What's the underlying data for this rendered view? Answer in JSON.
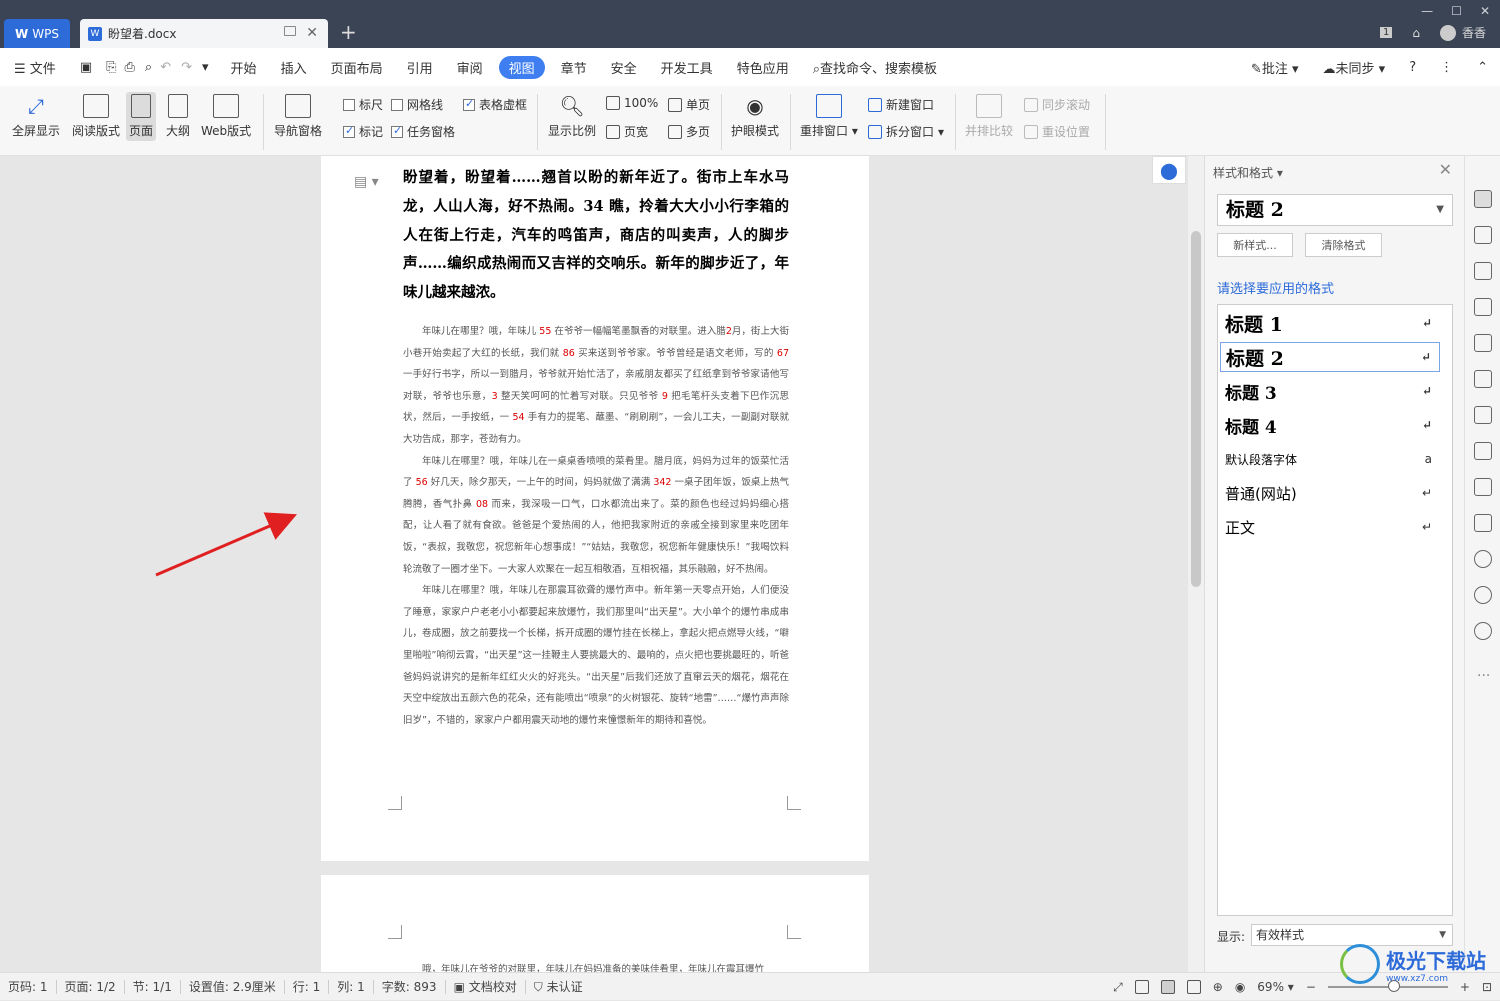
{
  "titlebar": {
    "app_tab": "WPS",
    "doc_tab": "盼望着.docx",
    "new_tab": "+",
    "account_name": "香香"
  },
  "menu": {
    "file": "文件",
    "items": [
      "开始",
      "插入",
      "页面布局",
      "引用",
      "审阅",
      "视图",
      "章节",
      "安全",
      "开发工具",
      "特色应用"
    ],
    "active": "视图",
    "search": "查找命令、搜索模板",
    "right": {
      "comment": "批注",
      "sync": "未同步"
    }
  },
  "ribbon": {
    "fullscreen": "全屏显示",
    "reading": "阅读版式",
    "page": "页面",
    "outline": "大纲",
    "web": "Web版式",
    "nav_pane": "导航窗格",
    "ruler": "标尺",
    "gridlines": "网格线",
    "table_gridlines": "表格虚框",
    "marks": "标记",
    "task_pane": "任务窗格",
    "zoom": "显示比例",
    "zoom_100": "100%",
    "single_page": "单页",
    "page_width": "页宽",
    "multi_page": "多页",
    "eye_mode": "护眼模式",
    "arrange": "重排窗口",
    "new_window": "新建窗口",
    "split_window": "拆分窗口",
    "side_by_side": "并排比较",
    "sync_scroll": "同步滚动",
    "reset_position": "重设位置"
  },
  "document": {
    "heading": "盼望着，盼望着……翘首以盼的新年近了。街市上车水马龙，人山人海，好不热闹。34 瞧，拎着大大小小行李箱的人在街上行走，汽车的鸣笛声，商店的叫卖声，人的脚步声……编织成热闹而又吉祥的交响乐。新年的脚步近了，年味儿越来越浓。",
    "p1": [
      {
        "t": "年味儿在哪里？哦，年味儿 "
      },
      {
        "t": "55",
        "red": true
      },
      {
        "t": " 在爷爷一幅幅笔墨飘香的对联里。进入腊"
      },
      {
        "t": "2",
        "red": true
      },
      {
        "t": "月，街上大街小巷开始卖起了大红的长纸，我们就 "
      },
      {
        "t": "86",
        "red": true
      },
      {
        "t": " 买来送到爷爷家。爷爷曾经是语文老师，写的 "
      },
      {
        "t": "67",
        "red": true
      },
      {
        "t": " 一手好行书字，所以一到腊月，爷爷就开始忙活了，亲戚朋友都买了红纸拿到爷爷家请他写对联，爷爷也乐意，"
      },
      {
        "t": "3",
        "red": true
      },
      {
        "t": " 整天笑呵呵的忙着写对联。只见爷爷 "
      },
      {
        "t": "9",
        "red": true
      },
      {
        "t": " 把毛笔杆头支着下巴作沉思状，然后，一手按纸，一 "
      },
      {
        "t": "54",
        "red": true
      },
      {
        "t": " 手有力的提笔、蘸墨、“刷刷刷”，一会儿工夫，一副副对联就大功告成，那字，苍劲有力。"
      }
    ],
    "p2": [
      {
        "t": "年味儿在哪里？哦，年味儿在一桌桌香喷喷的菜肴里。腊月底，妈妈为过年的饭菜忙活了 "
      },
      {
        "t": "56",
        "red": true
      },
      {
        "t": " 好几天，除夕那天，一上午的时间，妈妈就做了满满 "
      },
      {
        "t": "342",
        "red": true
      },
      {
        "t": " 一桌子团年饭，饭桌上热气腾腾，香气扑鼻 "
      },
      {
        "t": "08",
        "red": true
      },
      {
        "t": " 而来，我深吸一口气，口水都流出来了。菜的颜色也经过妈妈细心搭配，让人看了就有食欲。爸爸是个爱热闹的人，他把我家附近的亲戚全接到家里来吃团年饭，“表叔，我敬您，祝您新年心想事成！”“姑姑，我敬您，祝您新年健康快乐！”我喝饮料轮流敬了一圈才坐下。一大家人欢聚在一起互相敬酒，互相祝福，其乐融融，好不热闹。"
      }
    ],
    "p3": "年味儿在哪里？哦，年味儿在那震耳欲聋的爆竹声中。新年第一天零点开始，人们便没了睡意，家家户户老老小小都要起来放爆竹，我们那里叫“出天星”。大小单个的爆竹串成串儿，卷成圈，放之前要找一个长梯，拆开成圈的爆竹挂在长梯上，拿起火把点燃导火线，“噼里啪啦”响彻云霄，“出天星”这一挂鞭主人要挑最大的、最响的，点火把也要挑最旺的，听爸爸妈妈说讲究的是新年红红火火的好兆头。“出天星”后我们还放了直窜云天的烟花，烟花在天空中绽放出五颜六色的花朵，还有能喷出“喷泉”的火树银花、旋转“地雷”……“爆竹声声除旧岁”，不错的，家家户户都用震天动地的爆竹来憧憬新年的期待和喜悦。",
    "page2_text": "哦，年味儿在爷爷的对联里，年味儿在妈妈准备的美味佳肴里，年味儿在震耳爆竹里……年味儿更是浓浓的亲情和美好祝福。"
  },
  "panel": {
    "title": "样式和格式",
    "current_style": "标题 2",
    "new_style": "新样式...",
    "clear_format": "清除格式",
    "apply_label": "请选择要应用的格式",
    "styles": [
      {
        "name": "标题 1",
        "mark": "↵"
      },
      {
        "name": "标题 2",
        "mark": "↵"
      },
      {
        "name": "标题 3",
        "mark": "↵"
      },
      {
        "name": "标题 4",
        "mark": "↵"
      },
      {
        "name": "默认段落字体",
        "mark": "a"
      },
      {
        "name": "普通(网站)",
        "mark": "↵"
      },
      {
        "name": "正文",
        "mark": "↵"
      }
    ],
    "display_label": "显示:",
    "display_value": "有效样式"
  },
  "status": {
    "page_code": "页码: 1",
    "page": "页面: 1/2",
    "section": "节: 1/1",
    "setting": "设置值: 2.9厘米",
    "row": "行: 1",
    "col": "列: 1",
    "word_count": "字数: 893",
    "proofread": "文档校对",
    "cert": "未认证",
    "zoom": "69%"
  },
  "watermark": {
    "name": "极光下载站",
    "url": "www.xz7.com"
  },
  "colors": {
    "accent": "#3e7ef0",
    "titlebar": "#3b4454",
    "red_annotation": "#d00000",
    "arrow": "#e02020"
  }
}
